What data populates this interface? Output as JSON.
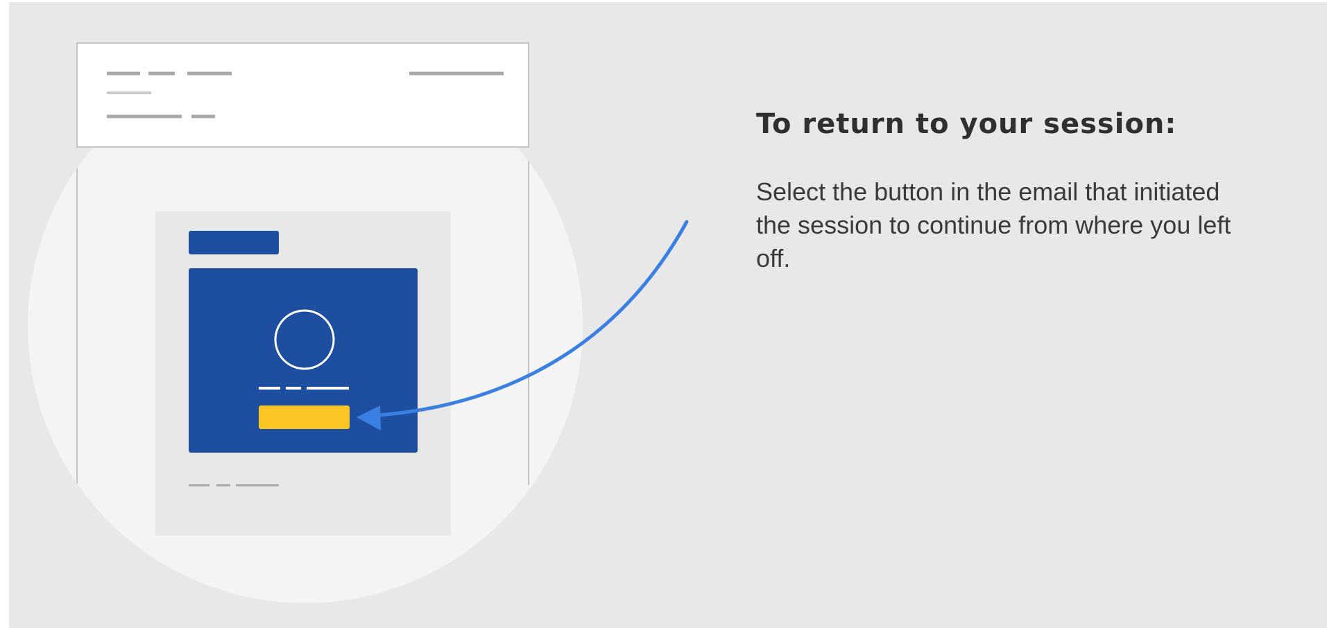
{
  "instructions": {
    "heading": "To return to your session:",
    "body": "Select the button in the email that initiated the session to continue from where you left off."
  },
  "illustration": {
    "icon": "email-with-button-illustration",
    "colors": {
      "background": "#e8e8e8",
      "circle": "#f4f4f4",
      "email_card": "#1e4ea0",
      "cta_button": "#fbc523",
      "arrow": "#3a80e3"
    }
  }
}
